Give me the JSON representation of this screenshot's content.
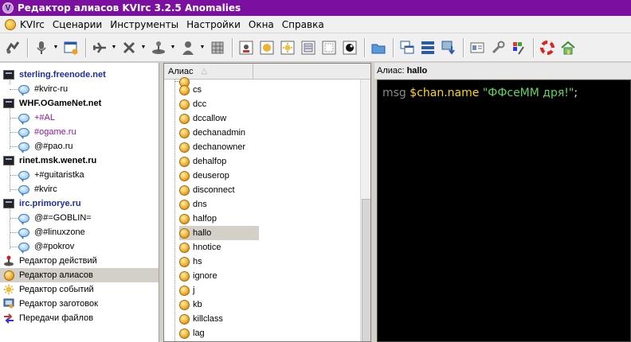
{
  "window": {
    "title": "Редактор алиасов KVIrc 3.2.5 Anomalies",
    "app_icon_letter": "V"
  },
  "menu": [
    "KVIrc",
    "Сценарии",
    "Инструменты",
    "Настройки",
    "Окна",
    "Справка"
  ],
  "toolbar_icons": [
    "connect-icon",
    "microphone-icon",
    "new-window-icon",
    "plane-icon",
    "tools-icon",
    "joystick-icon",
    "user-icon",
    "server-icon",
    "console-icon",
    "smiley-icon",
    "sun-icon",
    "document-icon",
    "window-icon",
    "circle-icon",
    "folder-icon",
    "cascade-icon",
    "tile-icon",
    "download-icon",
    "card-icon",
    "wrench-icon",
    "paint-icon",
    "help-lifebuoy-icon",
    "home-icon"
  ],
  "tree": {
    "servers": [
      {
        "name": "sterling.freenode.net",
        "active": true,
        "channels": [
          {
            "name": "#kvirc-ru",
            "highlight": false
          }
        ]
      },
      {
        "name": "WHF.OGameNet.net",
        "active": false,
        "channels": [
          {
            "name": "+#AL",
            "highlight": true
          },
          {
            "name": "#ogame.ru",
            "highlight": true
          },
          {
            "name": "@#pao.ru",
            "highlight": false
          }
        ]
      },
      {
        "name": "rinet.msk.wenet.ru",
        "active": false,
        "channels": [
          {
            "name": "+#guitaristka",
            "highlight": false
          },
          {
            "name": "#kvirc",
            "highlight": false
          }
        ]
      },
      {
        "name": "irc.primorye.ru",
        "active": true,
        "channels": [
          {
            "name": "@#=GOBLIN=",
            "highlight": false
          },
          {
            "name": "@#linuxzone",
            "highlight": false
          },
          {
            "name": "@#pokrov",
            "highlight": false
          }
        ]
      }
    ],
    "tools": [
      {
        "label": "Редактор действий",
        "icon": "joystick-icon",
        "selected": false
      },
      {
        "label": "Редактор алиасов",
        "icon": "alias-ball-icon",
        "selected": true
      },
      {
        "label": "Редактор событий",
        "icon": "event-sun-icon",
        "selected": false
      },
      {
        "label": "Редактор заготовок",
        "icon": "template-monitor-icon",
        "selected": false
      },
      {
        "label": "Передачи файлов",
        "icon": "file-transfer-icon",
        "selected": false
      }
    ]
  },
  "alias_list": {
    "column_header": "Алиас",
    "sort_indicator": "△",
    "items": [
      "cs",
      "dcc",
      "dccallow",
      "dechanadmin",
      "dechanowner",
      "dehalfop",
      "deuserop",
      "disconnect",
      "dns",
      "halfop",
      "hallo",
      "hnotice",
      "hs",
      "ignore",
      "j",
      "kb",
      "killclass",
      "lag"
    ],
    "selected": "hallo"
  },
  "editor": {
    "label_prefix": "Алиас:",
    "alias_name": "hallo",
    "code": {
      "command": "msg",
      "variable": "$chan.name",
      "string": "\"ФФсеММ дря!\"",
      "terminator": ";"
    },
    "colors": {
      "background": "#000000",
      "command": "#8a8a8a",
      "variable": "#ffd700",
      "string": "#5bd85b"
    }
  }
}
